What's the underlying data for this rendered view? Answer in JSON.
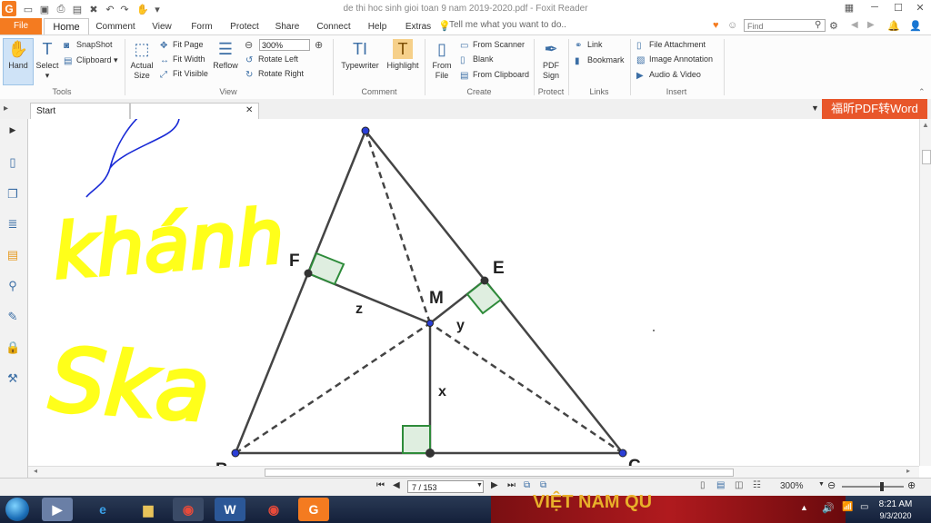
{
  "app": {
    "logo": "G",
    "window_title": "de thi hoc sinh gioi toan 9 nam 2019-2020.pdf - Foxit Reader"
  },
  "tabs": {
    "file": "File",
    "home": "Home",
    "others": [
      "Comment",
      "View",
      "Form",
      "Protect",
      "Share",
      "Connect",
      "Help",
      "Extras"
    ],
    "tell_me": "Tell me what you want to do..",
    "find_placeholder": "Find"
  },
  "ribbon": {
    "tools": {
      "hand": "Hand",
      "select": "Select",
      "snapshot": "SnapShot",
      "clipboard": "Clipboard",
      "label": "Tools"
    },
    "view": {
      "actual_size": "Actual Size",
      "fit_page": "Fit Page",
      "fit_width": "Fit Width",
      "fit_visible": "Fit Visible",
      "reflow": "Reflow",
      "zoom": "300%",
      "rotate_left": "Rotate Left",
      "rotate_right": "Rotate Right",
      "label": "View"
    },
    "comment": {
      "typewriter": "Typewriter",
      "highlight": "Highlight",
      "label": "Comment"
    },
    "create": {
      "from_file": "From File",
      "from_scanner": "From Scanner",
      "blank": "Blank",
      "from_clipboard": "From Clipboard",
      "label": "Create"
    },
    "protect": {
      "pdf_sign": "PDF Sign",
      "label": "Protect"
    },
    "links": {
      "link": "Link",
      "bookmark": "Bookmark",
      "label": "Links"
    },
    "insert": {
      "file_attachment": "File Attachment",
      "image_annotation": "Image Annotation",
      "audio_video": "Audio & Video",
      "label": "Insert"
    }
  },
  "doc_tabs": {
    "start": "Start",
    "promo": "福昕PDF转Word"
  },
  "figure": {
    "label_F": "F",
    "label_E": "E",
    "label_M": "M",
    "label_z": "z",
    "label_y": "y",
    "label_x": "x",
    "label_B": "B",
    "label_C": "C",
    "handwriting_1": "khánh",
    "handwriting_2": "Ska"
  },
  "status": {
    "page": "7 / 153",
    "zoom": "300%"
  },
  "taskbar": {
    "word_label": "W",
    "time": "8:21 AM",
    "date": "9/3/2020",
    "banner": "VIỆT NAM QU"
  },
  "colors": {
    "accent": "#f47b20",
    "promo": "#e8562a",
    "highlight_yellow": "#ffff1a",
    "scribble_blue": "#1a2bd6",
    "right_angle_green": "#2e8b3a",
    "point_blue": "#2b3fd6"
  }
}
